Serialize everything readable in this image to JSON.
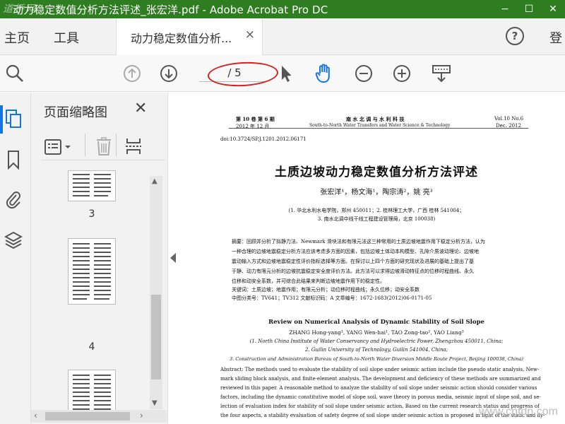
{
  "window": {
    "title": "动力稳定数值分析方法评述_张宏洋.pdf - Adobe Acrobat Pro DC",
    "watermark_logo": "道桥网",
    "minimize": "−",
    "maximize": "☐",
    "close": "✕"
  },
  "nav": {
    "home": "主页",
    "tools": "工具",
    "doc_tab": "动力稳定数值分析...",
    "doc_tab_close": "×",
    "help": "?",
    "login": "登"
  },
  "toolbar": {
    "page_indicator": "/ 5"
  },
  "thumbnails_panel": {
    "title": "页面缩略图",
    "close": "✕",
    "page_numbers": [
      "3",
      "4"
    ]
  },
  "document": {
    "header_left_1": "第 10 卷   第 6 期",
    "header_left_2": "2012 年 12 月",
    "header_center_1": "南 水 北 调 与 水 利 科 技",
    "header_center_2": "South-to-North Water Transfers and Water Science & Technology",
    "header_right_1": "Vol.10   No.6",
    "header_right_2": "Dec. 2012",
    "doi": "doi:10.3724/SP.J.1201.2012.06171",
    "title_cn": "土质边坡动力稳定数值分析方法评述",
    "authors_cn": "张宏洋¹，杨文海¹，陶宗涛²，姚    亮³",
    "affiliation_cn_1": "(1. 华北水利水电学院，郑州 450011；2. 桂林理工大学，广西 桂林 541004；",
    "affiliation_cn_2": "3. 南水北调中线干线工程建设管理局，北京 100038)",
    "abstract_cn_1": "摘要：回顾并分析了拟静力法、Newmark 滑块法和有限元法这三种常用的土质边坡地震作用下稳定分析方法，认为",
    "abstract_cn_2": "一种合理的边坡地震稳定分析方法应该考虑多方面的因素，包括边坡土体动本构模型、孔隙介质波动理论、边坡地",
    "abstract_cn_3": "震动输入方式和边坡地震稳定性评价指标选择等方面。在探讨以上四个方面的研究现状及进展的基础上提出了基",
    "abstract_cn_4": "于静、动力有限元分析的边坡抗震稳定安全度评价方法。此方法可以求得边坡滑动特征点的位移时程曲线、永久",
    "abstract_cn_5": "位移和动安全系数，并可综合此结果来判断边坡地震作用下的稳定性。",
    "keywords_cn": "关键词：土质边坡；地震作用；有限元分析；动位移时程曲线；永久位移；动安全系数",
    "classification_cn": "中图分类号：TV641；TV312        文献标识码：A        文章编号：1672-1683(2012)06-0171-05",
    "title_en": "Review on Numerical Analysis of Dynamic Stability of Soil Slope",
    "authors_en": "ZHANG Hong-yang¹, YANG Wen-hai¹, TAO Zong-tao², YAO Liang³",
    "affiliation_en_1": "(1. North China Institute of Water Conservancy and Hydroelectric Power, Zhengzhou 450011, China;",
    "affiliation_en_2": "2. Guilin University of Technology, Guilin 541004, China;",
    "affiliation_en_3": "3. Construction and Administration Bureau of South-to-North Water Diversion Middle Route Project, Beijing 100038, China)",
    "abstract_en_1": "Abstract: The methods used to evaluate the stability of soil slope under seismic action include the pseudo static analysis, New-",
    "abstract_en_2": "mark sliding block analysis, and finite-element analysis. The development and deficiency of these methods are summarized and",
    "abstract_en_3": "reviewed in this paper. A reasonable method to analyze the stability of soil slope under seismic action should consider various",
    "abstract_en_4": "factors, including the dynamic constitutive model of slope soil, wave theory in porous media, seismic input of slope soil, and se-",
    "abstract_en_5": "lection of evaluation index for stability of soil slope under seismic action. Based on the current research status and progress of",
    "abstract_en_6": "the four aspects, a stability evaluation of safety degree of soil slope under seismic action is proposed in light of the static and dy-",
    "watermark": "www.cntdn.com"
  },
  "colors": {
    "titlebar": "#2e7d20",
    "accent": "#1473e6",
    "annotation": "#d42020"
  }
}
